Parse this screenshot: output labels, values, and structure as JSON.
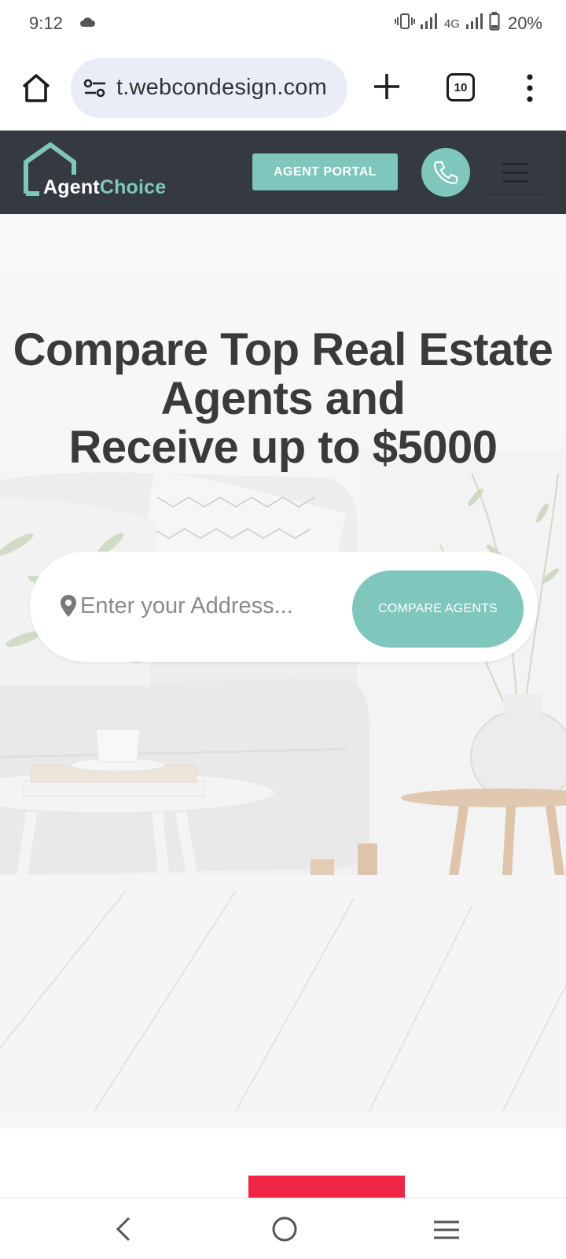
{
  "status_bar": {
    "time": "9:12",
    "network": "4G",
    "battery": "20%",
    "icons": [
      "cloud-icon",
      "vibrate-icon",
      "signal-icon",
      "signal-icon",
      "battery-icon"
    ]
  },
  "browser": {
    "url": "t.webcondesign.com",
    "tab_count": "10",
    "icons": [
      "home-icon",
      "site-settings-icon",
      "new-tab-icon",
      "tabs-icon",
      "more-menu-icon"
    ]
  },
  "header": {
    "logo_agent": "Agent",
    "logo_choice": "Choice",
    "agent_portal_label": "AGENT PORTAL",
    "phone_icon": "phone-icon",
    "menu_icon": "hamburger-icon"
  },
  "hero": {
    "title_line1": "Compare Top Real Estate",
    "title_line2": "Agents and",
    "title_line3": "Receive up to $5000",
    "address_placeholder": "Enter your Address...",
    "compare_label": "COMPARE AGENTS",
    "pin_icon": "map-pin-icon"
  },
  "colors": {
    "accent": "#7fc6bc",
    "header_bg": "#343a40",
    "title_text": "#3a3a3a",
    "red_block": "#ee2544"
  },
  "nav_bar": {
    "icons": [
      "back-icon",
      "home-circle-icon",
      "recents-icon"
    ]
  }
}
